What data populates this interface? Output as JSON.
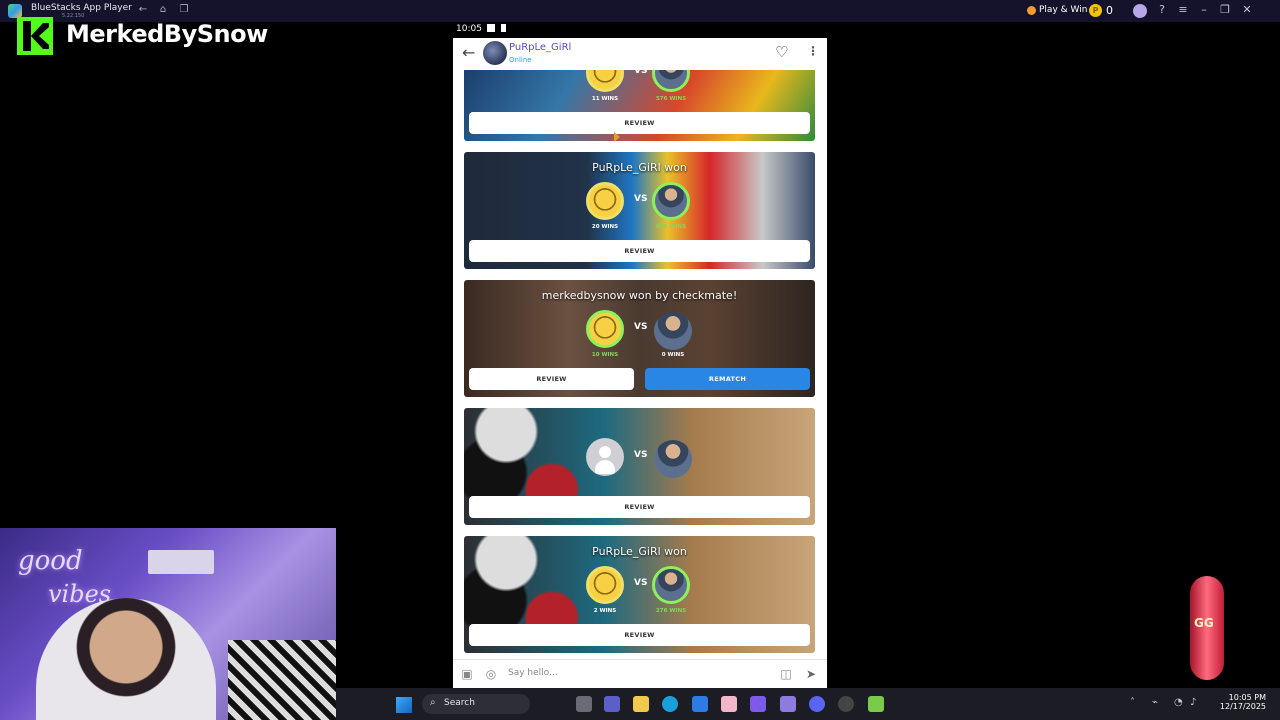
{
  "bluestacks": {
    "app_title": "BlueStacks App Player",
    "subtitle": "5.22.150",
    "play_win_label": "Play & Win",
    "coin_count": "0"
  },
  "overlay": {
    "channel_name": "MerkedBySnow"
  },
  "phone": {
    "status_time": "10:05",
    "header": {
      "username": "PuRpLe_GiRl",
      "status": "Online"
    },
    "cards": [
      {
        "title": "",
        "left_wins": "11 WINS",
        "right_wins": "576 WINS",
        "buttons": [
          "REVIEW"
        ]
      },
      {
        "title": "PuRpLe_GiRl won",
        "left_wins": "20 WINS",
        "right_wins": "885 WINS",
        "buttons": [
          "REVIEW"
        ]
      },
      {
        "title": "merkedbysnow won by checkmate!",
        "left_wins": "10 WINS",
        "right_wins": "0 WINS",
        "buttons": [
          "REVIEW",
          "REMATCH"
        ]
      },
      {
        "title": "",
        "left_wins": "",
        "right_wins": "",
        "buttons": [
          "REVIEW"
        ]
      },
      {
        "title": "PuRpLe_GiRl won",
        "left_wins": "2 WINS",
        "right_wins": "276 WINS",
        "buttons": [
          "REVIEW"
        ]
      }
    ],
    "vs_label": "VS",
    "input": {
      "placeholder": "Say hello..."
    }
  },
  "webcam": {
    "neon_line1": "good",
    "neon_line2": "vibes"
  },
  "taskbar": {
    "search_label": "Search",
    "time": "10:05 PM",
    "date": "12/17/2025"
  },
  "colors": {
    "accent_blue": "#2a86e4",
    "win_green": "#86d65b",
    "username_purple": "#5b49c5",
    "kick_green": "#53fc18"
  }
}
